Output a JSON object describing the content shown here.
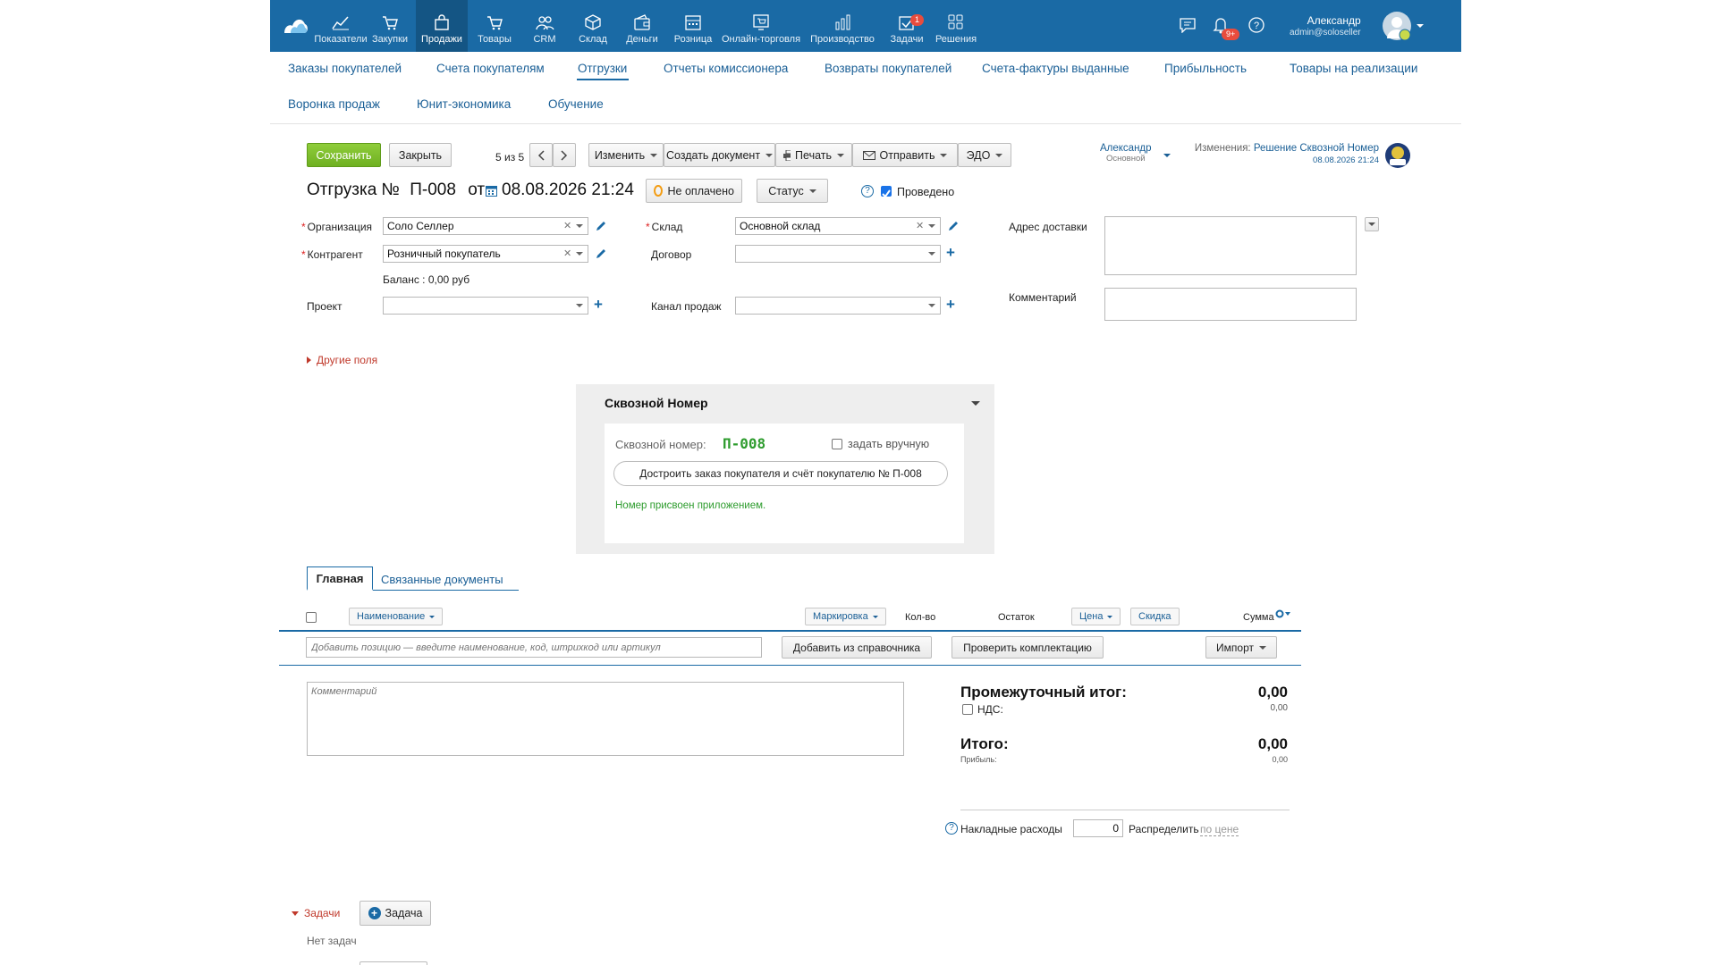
{
  "nav": {
    "items": [
      {
        "label": "Показатели",
        "icon": "chart-line-icon"
      },
      {
        "label": "Закупки",
        "icon": "cart-down-icon"
      },
      {
        "label": "Продажи",
        "icon": "bag-icon",
        "active": true
      },
      {
        "label": "Товары",
        "icon": "cart-icon"
      },
      {
        "label": "CRM",
        "icon": "people-icon"
      },
      {
        "label": "Склад",
        "icon": "box-icon"
      },
      {
        "label": "Деньги",
        "icon": "wallet-icon"
      },
      {
        "label": "Розница",
        "icon": "register-icon"
      },
      {
        "label": "Онлайн-торговля",
        "icon": "online-store-icon"
      },
      {
        "label": "Производство",
        "icon": "bar-chart-icon"
      },
      {
        "label": "Задачи",
        "icon": "tasks-icon",
        "badge": "1"
      },
      {
        "label": "Решения",
        "icon": "grid-apps-icon"
      }
    ],
    "notif_badge": "9+",
    "user_name": "Александр",
    "user_email": "admin@soloseller"
  },
  "subnav": {
    "row1": [
      "Заказы покупателей",
      "Счета покупателям",
      "Отгрузки",
      "Отчеты комиссионера",
      "Возвраты покупателей",
      "Счета-фактуры выданные",
      "Прибыльность",
      "Товары на реализации"
    ],
    "row2": [
      "Воронка продаж",
      "Юнит-экономика",
      "Обучение"
    ]
  },
  "toolbar": {
    "save": "Сохранить",
    "close": "Закрыть",
    "pager": "5 из 5",
    "edit": "Изменить",
    "create_doc": "Создать документ",
    "print": "Печать",
    "send": "Отправить",
    "edo": "ЭДО",
    "owner": "Александр",
    "owner_sub": "Основной",
    "changes_label": "Изменения:",
    "changes_value": "Решение Сквозной Номер",
    "changes_date": "08.08.2026 21:24"
  },
  "doc": {
    "title_prefix": "Отгрузка №",
    "number": "П-008",
    "from": "от",
    "date": "08.08.2026 21:24",
    "payment_status": "Не оплачено",
    "status": "Статус",
    "posted": "Проведено"
  },
  "form": {
    "org_label": "Организация",
    "org_value": "Соло Селлер",
    "counterparty_label": "Контрагент",
    "counterparty_value": "Розничный покупатель",
    "balance": "Баланс : 0,00 руб",
    "project_label": "Проект",
    "warehouse_label": "Склад",
    "warehouse_value": "Основной склад",
    "contract_label": "Договор",
    "channel_label": "Канал продаж",
    "address_label": "Адрес доставки",
    "comment_label": "Комментарий",
    "other_fields": "Другие поля"
  },
  "panel": {
    "title": "Сквозной Номер",
    "number_label": "Сквозной номер:",
    "number_value": "П-008",
    "manual": "задать вручную",
    "build_button": "Достроить заказ покупателя и счёт покупателю № П-008",
    "note": "Номер присвоен приложением."
  },
  "tabs": [
    "Главная",
    "Связанные документы"
  ],
  "table": {
    "name": "Наименование",
    "marking": "Маркировка",
    "qty": "Кол-во",
    "stock": "Остаток",
    "price": "Цена",
    "discount": "Скидка",
    "sum": "Сумма",
    "add_placeholder": "Добавить позицию — введите наименование, код, штрихкод или артикул",
    "add_from_catalog": "Добавить из справочника",
    "check_kit": "Проверить комплектацию",
    "import": "Импорт"
  },
  "totals": {
    "comment_placeholder": "Комментарий",
    "subtotal_label": "Промежуточный итог:",
    "subtotal_value": "0,00",
    "vat_label": "НДС:",
    "vat_value": "0,00",
    "total_label": "Итого:",
    "total_value": "0,00",
    "profit_label": "Прибыль:",
    "profit_value": "0,00",
    "overhead_label": "Накладные расходы",
    "overhead_value": "0",
    "distribute_label": "Распределить",
    "distribute_value": "по цене"
  },
  "tasks": {
    "label": "Задачи",
    "add": "Задача",
    "empty": "Нет задач"
  },
  "colors": {
    "header": "#1a6aa5",
    "accent_green": "#6fb021",
    "link": "#1a5f96"
  }
}
